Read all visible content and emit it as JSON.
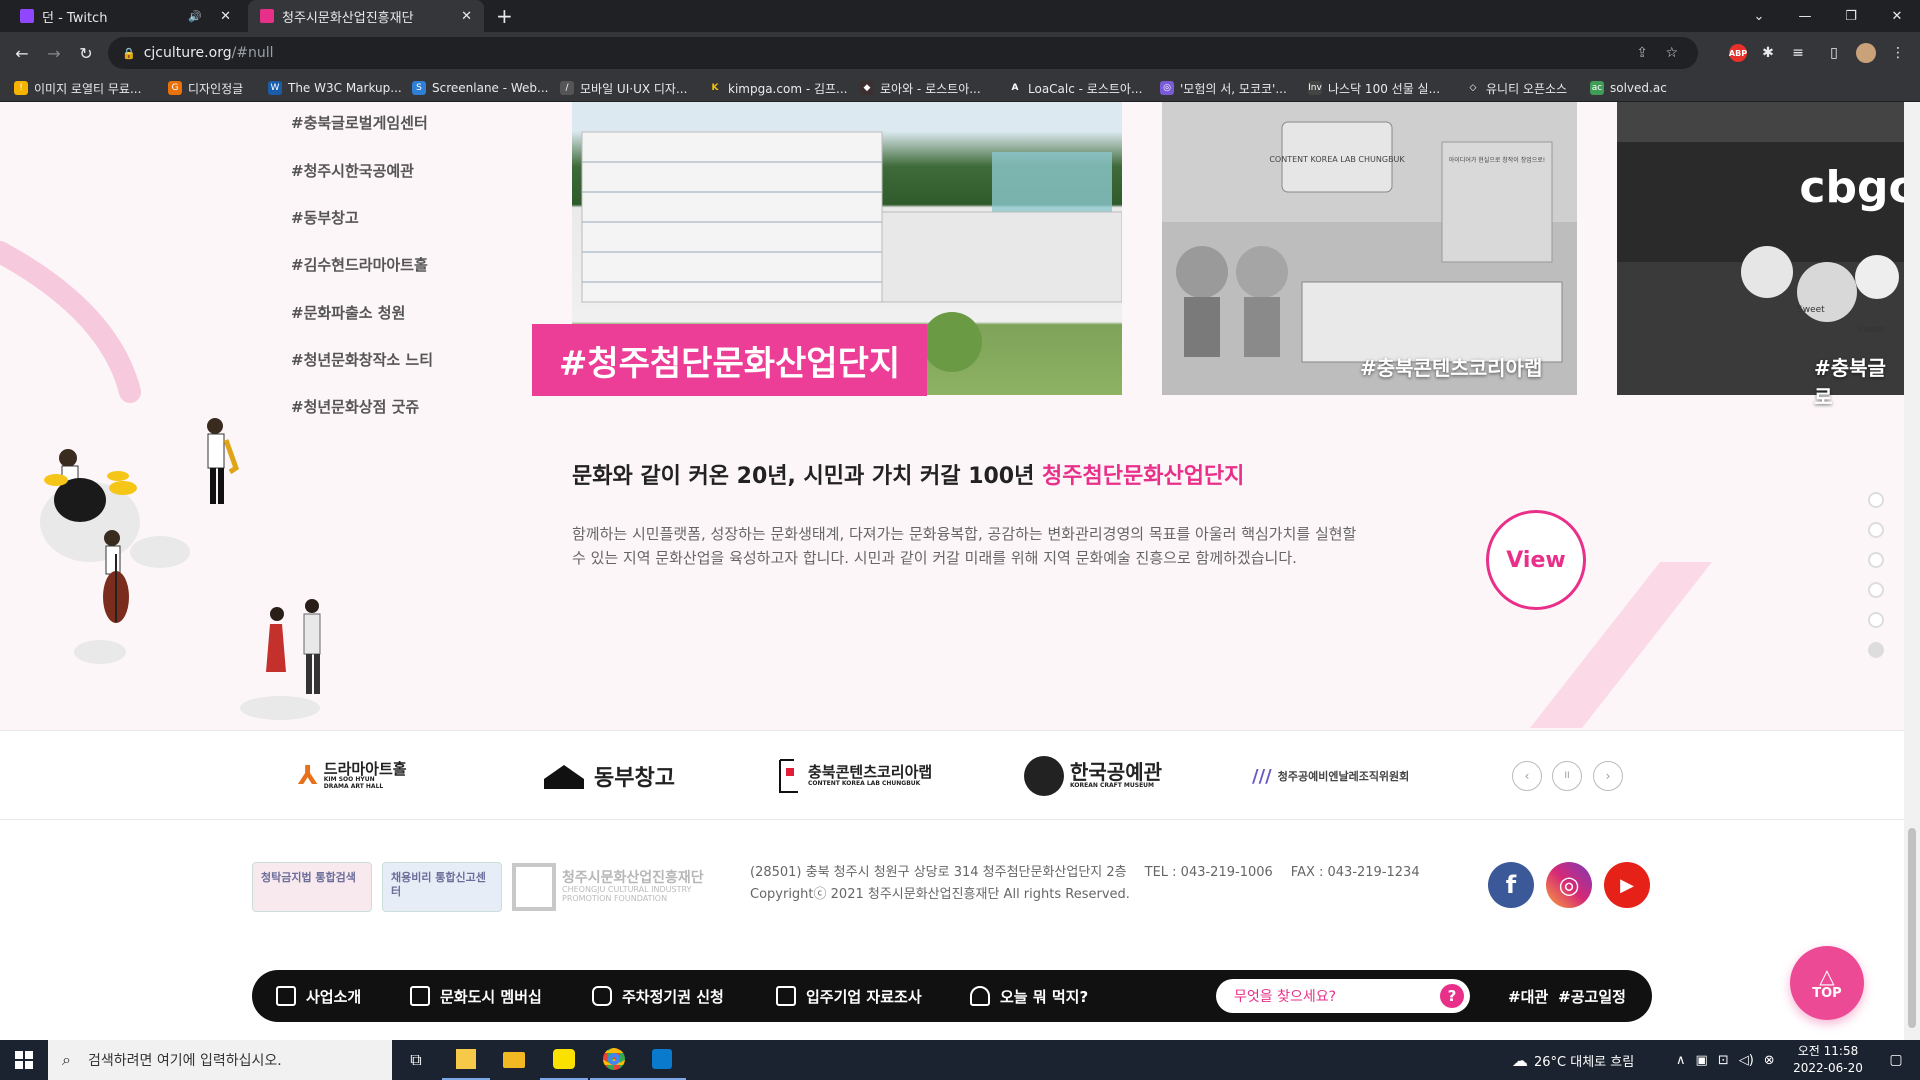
{
  "browser": {
    "tabs": [
      {
        "label": "던    - Twitch",
        "favicon": "twitch-icon",
        "active": false
      },
      {
        "label": "청주시문화산업진흥재단",
        "favicon": "site-icon",
        "active": true
      }
    ],
    "new_tab_symbol": "+",
    "url_host": "cjculture.org",
    "url_path": "/#null",
    "bookmarks": [
      "이미지 로열티 무료...",
      "디자인정글",
      "The W3C Markup...",
      "Screenlane - Web...",
      "모바일 UI·UX 디자...",
      "kimpga.com - 김프...",
      "로아와 - 로스트아...",
      "LoaCalc - 로스트아...",
      "'모험의 서, 모코코'...",
      "나스닥 100 선물 실...",
      "유니티 오픈소스",
      "solved.ac"
    ],
    "extension_badge": "ABP"
  },
  "page": {
    "tag_list": [
      "#충북글로벌게임센터",
      "#청주시한국공예관",
      "#동부창고",
      "#김수현드라마아트홀",
      "#문화파출소 청원",
      "#청년문화창작소 느티",
      "#청년문화상점 굿쥬"
    ],
    "slides": [
      {
        "label": "#청주첨단문화산업단지"
      },
      {
        "label": "#충북콘텐츠코리아랩"
      },
      {
        "label": "#충북글로"
      }
    ],
    "photo_signage": {
      "lab_sign": "CONTENT KOREA LAB CHUNGBUK",
      "lab_wall": "아이디어가 현실으로 창작이 창업으로!",
      "game_center_logo": "cbgc",
      "mural_words": [
        "Sweet",
        "Sweet"
      ]
    },
    "headline_main": "문화와 같이 커온 20년, 시민과 가치 커갈 100년 ",
    "headline_accent": "청주첨단문화산업단지",
    "description": "함께하는 시민플랫폼, 성장하는 문화생태계, 다져가는 문화융복합, 공감하는 변화관리경영의 목표를 아울러 핵심가치를 실현할 수 있는 지역 문화산업을 육성하고자 합니다. 시민과 같이 커갈 미래를 위해 지역 문화예술 진흥으로 함께하겠습니다.",
    "view_label": "View",
    "pager_dots": 6,
    "pager_active": 6
  },
  "partners": {
    "items": [
      {
        "name": "드라마아트홀",
        "sub": "KIM SOO HYUN DRAMA ART HALL"
      },
      {
        "name": "동부창고",
        "sub": ""
      },
      {
        "name": "충북콘텐츠코리아랩",
        "sub": "CONTENT KOREA LAB CHUNGBUK"
      },
      {
        "name": "한국공예관",
        "sub": "KOREAN CRAFT MUSEUM"
      },
      {
        "name": "청주공예비엔날레조직위원회",
        "sub": ""
      }
    ],
    "prev": "‹",
    "pause": "II",
    "next": "›"
  },
  "footer": {
    "badge1": "청탁금지법 통합검색",
    "badge2": "채용비리 통합신고센터",
    "org_name": "청주시문화산업진흥재단",
    "org_sub": "CHEONGJU CULTURAL INDUSTRY PROMOTION FOUNDATION",
    "address": "(28501) 충북 청주시 청원구 상당로 314 청주첨단문화산업단지 2층",
    "tel": "TEL : 043-219-1006",
    "fax": "FAX : 043-219-1234",
    "copyright": "Copyrightⓒ 2021 청주시문화산업진흥재단 All rights Reserved.",
    "social": [
      {
        "name": "facebook",
        "glyph": "f",
        "color": "#3b5998"
      },
      {
        "name": "instagram",
        "glyph": "◎",
        "color": "#d62976"
      },
      {
        "name": "youtube",
        "glyph": "▶",
        "color": "#e62117"
      }
    ]
  },
  "quickbar": {
    "items": [
      "사업소개",
      "문화도시 멤버십",
      "주차정기권 신청",
      "입주기업 자료조사",
      "오늘 뭐 먹지?"
    ],
    "search_placeholder": "무엇을 찾으세요?",
    "search_button": "?",
    "tags": [
      "#대관",
      "#공고일정"
    ],
    "top_label": "TOP"
  },
  "taskbar": {
    "search_placeholder": "검색하려면 여기에 입력하십시오.",
    "weather": "26°C  대체로 흐림",
    "time": "오전 11:58",
    "date": "2022-06-20"
  },
  "colors": {
    "accent": "#e8308a",
    "banner": "#ec3e97",
    "dark": "#111111"
  }
}
